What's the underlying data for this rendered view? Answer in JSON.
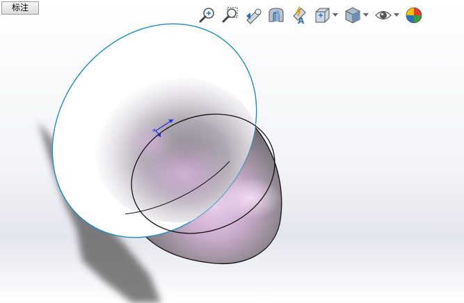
{
  "tab": {
    "label": "标注"
  },
  "toolbar": {
    "buttons": [
      {
        "icon": "zoom-to-fit-icon"
      },
      {
        "icon": "zoom-to-area-icon"
      },
      {
        "icon": "previous-view-icon"
      },
      {
        "icon": "section-view-icon"
      },
      {
        "icon": "dynamic-annotation-views-icon"
      },
      {
        "icon": "view-orientation-icon",
        "dropdown": true
      },
      {
        "icon": "display-style-icon",
        "dropdown": true
      },
      {
        "icon": "hide-show-items-icon",
        "dropdown": true
      },
      {
        "icon": "edit-appearance-icon"
      }
    ]
  },
  "colors": {
    "model_outline": "#1a8fc0",
    "edge": "#111111",
    "triad": "#1a33dd",
    "shadow": "#5a5a5a",
    "tint": "#d7b3dc"
  }
}
